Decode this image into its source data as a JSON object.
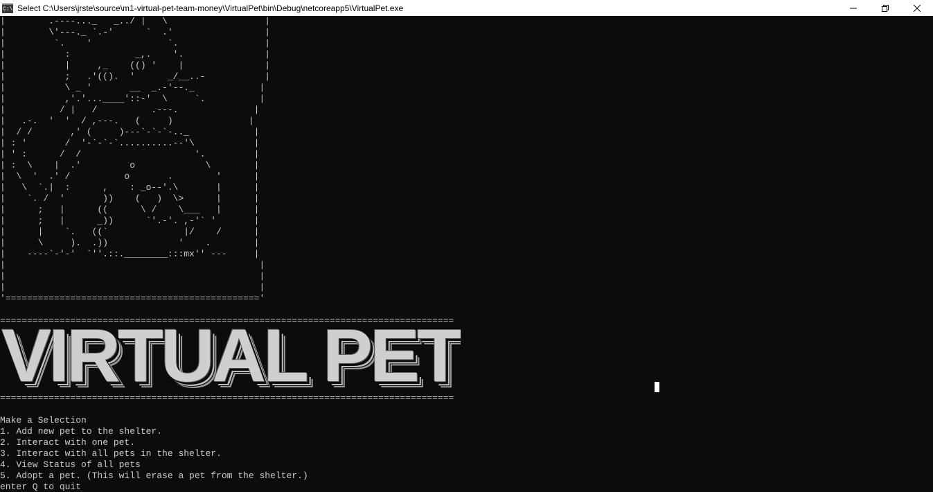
{
  "window": {
    "title": "Select C:\\Users\\jrste\\source\\m1-virtual-pet-team-money\\VirtualPet\\bin\\Debug\\netcoreapp5\\VirtualPet.exe",
    "icon": "console-app-icon",
    "icon_glyph": "C:\\",
    "controls": [
      "minimize-icon",
      "restore-icon",
      "close-icon"
    ]
  },
  "ascii_art": "|        .----..._   _../ |   \\                  |\n|        \\'---._ `.-'      `  .'                 |\n|         `.    '              `.                |\n|           :            _,.    '.               |\n|           |     ,_    (() '    |               |\n|           ;   .'(().  '      _/__..-           |\n|           \\ _ '       __  _.-'--._            |\n|           ,'.'...____'::-'  \\     `.          |\n|          / |   /          .---.              |\n|   .-.  '  '  / ,---.   (     )              |\n|  / /       ,' (     )---`-`-`-.._            |\n| : '       /  '-`-`-`..........--'\\           |\n| ' :      /  /                     '.         |\n| :  \\    |  .'         o             \\        |\n|  \\  '  .' /          o       .        '      |\n|   \\  `.|  :      ,    : _o--'.\\       |      |\n|    `. /  '       ))    (   )  \\>      |      |\n|      ;   |      ((      \\ /    \\___   |      |\n|      ;   |      _))      `'.-'. ,-'` '       |\n|      |    `.   ((`              |/    /      |\n|      \\     ).  .))             '    .        |\n|    ----`-'-'  `''.::.________:::mx'' ---     |\n|                                               |\n|                                               |\n|                                               |\n'==============================================='",
  "rule_top": "====================================================================================",
  "rule_bottom": "====================================================================================",
  "banner_text": "VIRTUAL PET",
  "menu": {
    "heading": "Make a Selection",
    "options": [
      "1. Add new pet to the shelter.",
      "2. Interact with one pet.",
      "3. Interact with all pets in the shelter.",
      "4. View Status of all pets",
      "5. Adopt a pet. (This will erase a pet from the shelter.)"
    ],
    "quit_prompt": "enter Q to quit"
  },
  "colors": {
    "background": "#0c0c0c",
    "text": "#cccccc",
    "titlebar": "#ffffff"
  }
}
